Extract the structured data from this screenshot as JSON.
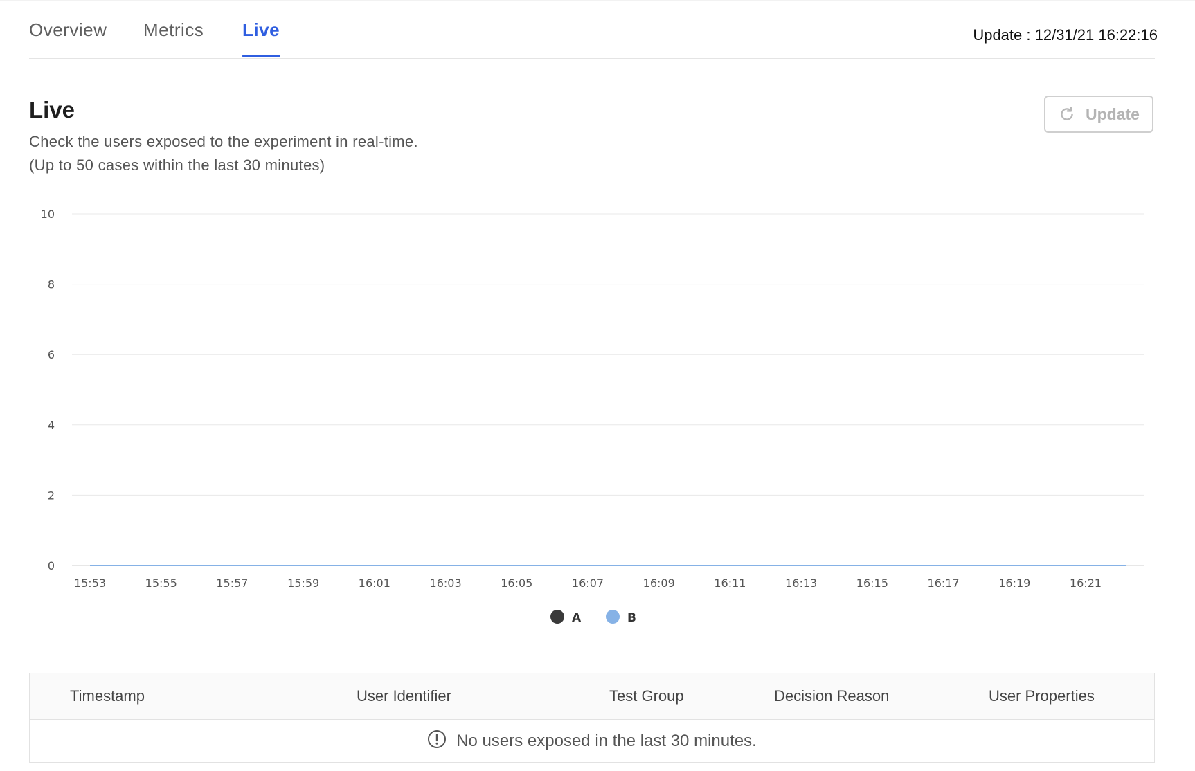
{
  "tabs": [
    {
      "label": "Overview",
      "active": false
    },
    {
      "label": "Metrics",
      "active": false
    },
    {
      "label": "Live",
      "active": true
    }
  ],
  "update_time": "Update : 12/31/21 16:22:16",
  "section": {
    "title": "Live",
    "description_line1": "Check the users exposed to the experiment in real-time.",
    "description_line2": "(Up to 50 cases within the last 30 minutes)",
    "update_button_label": "Update",
    "update_button_icon": "refresh-icon"
  },
  "colors": {
    "accent": "#2f5ee0",
    "series_a": "#3a3a3a",
    "series_b": "#86b2e6"
  },
  "chart_data": {
    "type": "line",
    "x_tick_labels": [
      "15:53",
      "15:55",
      "15:57",
      "15:59",
      "16:01",
      "16:03",
      "16:05",
      "16:07",
      "16:09",
      "16:11",
      "16:13",
      "16:15",
      "16:17",
      "16:19",
      "16:21"
    ],
    "ylim": [
      0,
      10
    ],
    "y_ticks": [
      0,
      2,
      4,
      6,
      8,
      10
    ],
    "grid": true,
    "legend_placement": "bottom-center",
    "series": [
      {
        "name": "A",
        "color": "#3a3a3a",
        "values": [
          0,
          0,
          0,
          0,
          0,
          0,
          0,
          0,
          0,
          0,
          0,
          0,
          0,
          0,
          0
        ]
      },
      {
        "name": "B",
        "color": "#86b2e6",
        "values": [
          0,
          0,
          0,
          0,
          0,
          0,
          0,
          0,
          0,
          0,
          0,
          0,
          0,
          0,
          0
        ]
      }
    ]
  },
  "table": {
    "columns": [
      "Timestamp",
      "User Identifier",
      "Test Group",
      "Decision Reason",
      "User Properties"
    ],
    "empty_message": "No users exposed in the last 30 minutes.",
    "empty_icon": "info-circle-icon"
  }
}
